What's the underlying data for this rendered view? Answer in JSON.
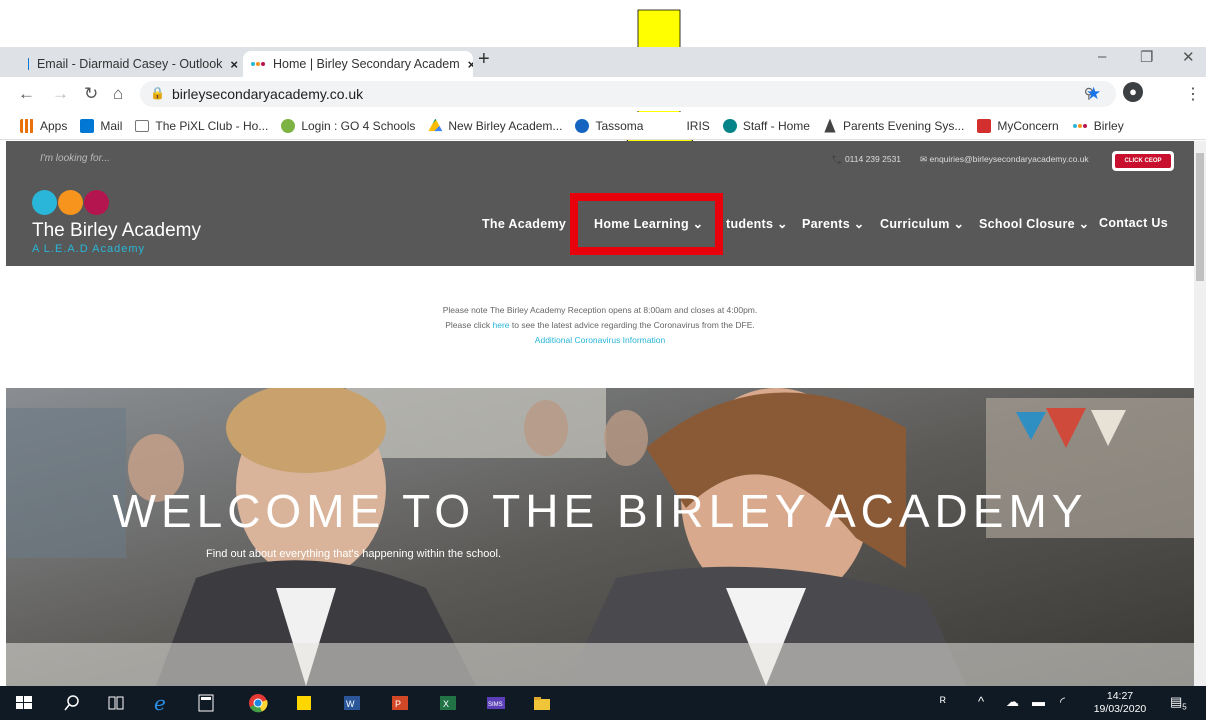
{
  "browser": {
    "tabs": [
      {
        "title": "Email - Diarmaid Casey - Outlook",
        "close": "×"
      },
      {
        "title": "Home | Birley Secondary Academ",
        "close": "×"
      }
    ],
    "new_tab": "+",
    "window_controls": {
      "minimize": "–",
      "restore": "❐",
      "close": "✕"
    },
    "url": "birleysecondaryacademy.co.uk",
    "bookmarks": [
      {
        "label": "Apps",
        "icon": "apps-grid-icon",
        "color": "#e8710a"
      },
      {
        "label": "Mail",
        "icon": "outlook-icon",
        "color": "#0078d4"
      },
      {
        "label": "The PiXL Club - Ho...",
        "icon": "pixl-icon",
        "color": "#555555"
      },
      {
        "label": "Login : GO 4 Schools",
        "icon": "go4schools-icon",
        "color": "#7cb342"
      },
      {
        "label": "New Birley Academ...",
        "icon": "google-drive-icon",
        "color": "#fbbc04"
      },
      {
        "label": "Tassoma",
        "icon": "tassomai-icon",
        "color": "#1565c0"
      },
      {
        "label": "IRIS",
        "icon": "iris-icon",
        "color": "#ffffff"
      },
      {
        "label": "Staff - Home",
        "icon": "sharepoint-icon",
        "color": "#038387"
      },
      {
        "label": "Parents Evening Sys...",
        "icon": "parents-evening-icon",
        "color": "#444444"
      },
      {
        "label": "MyConcern",
        "icon": "myconcern-icon",
        "color": "#d32f2f"
      },
      {
        "label": "Birley",
        "icon": "birley-dots-icon",
        "color": "#29b6d8"
      }
    ]
  },
  "site": {
    "search_placeholder": "I'm looking for...",
    "phone": "📞 0114 239 2531",
    "email": "✉ enquiries@birleysecondaryacademy.co.uk",
    "ceop_label": "CLICK CEOP",
    "brand_name": "The Birley Academy",
    "brand_sub": "A L.E.A.D Academy",
    "logo_colors": [
      "#29b6d8",
      "#f7941d",
      "#b5154f"
    ],
    "menu": [
      {
        "label": "The Academy ⌄"
      },
      {
        "label": "Home Learning ⌄"
      },
      {
        "label": "tudents ⌄"
      },
      {
        "label": "Parents ⌄"
      },
      {
        "label": "Curriculum ⌄"
      },
      {
        "label": "School Closure ⌄"
      },
      {
        "label": "Contact Us"
      }
    ],
    "notice": {
      "line1": "Please note The Birley Academy Reception opens at 8:00am and closes at 4:00pm.",
      "line2_pre": "Please click ",
      "line2_link": "here",
      "line2_post": " to see the latest advice regarding the Coronavirus from the DFE.",
      "line3_link": "Additional Coronavirus Information"
    },
    "hero_title": "WELCOME TO THE BIRLEY ACADEMY",
    "hero_subtitle": "Find out about everything that's happening within the school."
  },
  "annotation": {
    "arrow_color": "#ffff00",
    "box_color": "#e8000b"
  },
  "taskbar": {
    "time": "14:27",
    "date": "19/03/2020",
    "notifications": "5"
  }
}
